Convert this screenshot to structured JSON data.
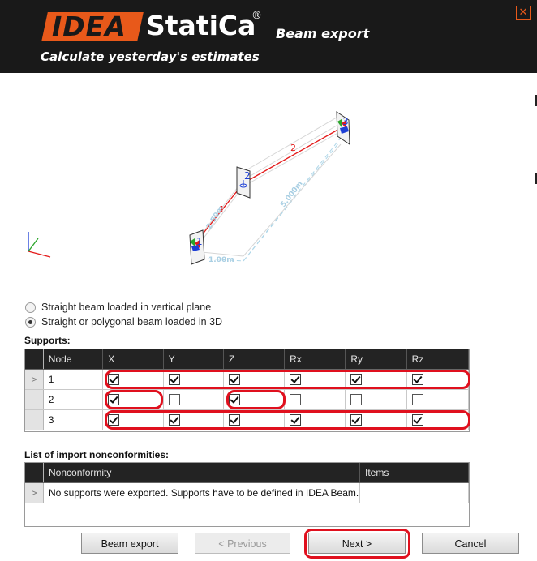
{
  "header": {
    "logo_mark": "IDEA",
    "logo_name": "StatiCa",
    "logo_reg": "®",
    "product": "Beam export",
    "slogan": "Calculate yesterday's estimates",
    "close_glyph": "✕",
    "accent": "#e8591a"
  },
  "model": {
    "node_labels": [
      "1",
      "2",
      "3"
    ],
    "member_labels": [
      "1",
      "2"
    ],
    "dimensions": [
      "2.50m",
      "5.000m",
      "1.00m"
    ],
    "member_color": "#e41a1a"
  },
  "beam_type": {
    "options": [
      {
        "label": "Straight beam loaded in vertical plane",
        "selected": false
      },
      {
        "label": "Straight or polygonal beam loaded in 3D",
        "selected": true
      }
    ]
  },
  "supports": {
    "title": "Supports:",
    "columns": [
      "Node",
      "X",
      "Y",
      "Z",
      "Rx",
      "Ry",
      "Rz"
    ],
    "rows": [
      {
        "node": "1",
        "current": true,
        "values": [
          true,
          true,
          true,
          true,
          true,
          true
        ]
      },
      {
        "node": "2",
        "current": false,
        "values": [
          true,
          false,
          true,
          false,
          false,
          false
        ]
      },
      {
        "node": "3",
        "current": false,
        "values": [
          true,
          true,
          true,
          true,
          true,
          true
        ]
      }
    ],
    "row_marker": ">"
  },
  "nonconformities": {
    "title": "List of import nonconformities:",
    "columns": [
      "Nonconformity",
      "Items"
    ],
    "rows": [
      {
        "text": "No supports were exported. Supports have to be defined in IDEA Beam.",
        "items": ""
      }
    ],
    "row_marker": ">"
  },
  "buttons": {
    "beam_export": "Beam export",
    "previous": "< Previous",
    "next": "Next >",
    "cancel": "Cancel"
  },
  "highlight_color": "#e0101e"
}
